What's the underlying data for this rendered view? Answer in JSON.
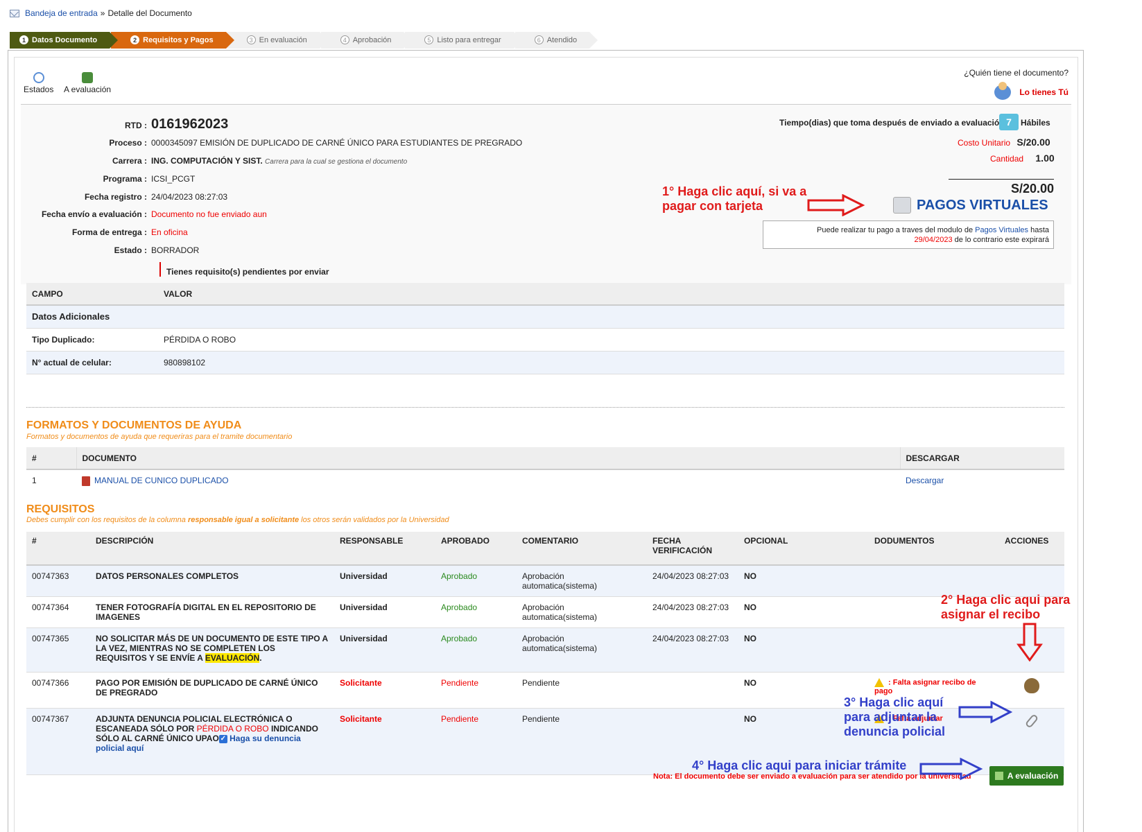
{
  "breadcrumb": {
    "inbox": "Bandeja de entrada",
    "sep": "»",
    "current": "Detalle del Documento"
  },
  "steps": [
    {
      "n": "1",
      "label": "Datos Documento",
      "state": "done"
    },
    {
      "n": "2",
      "label": "Requisitos y Pagos",
      "state": "active"
    },
    {
      "n": "3",
      "label": "En evaluación",
      "state": "pending"
    },
    {
      "n": "4",
      "label": "Aprobación",
      "state": "pending"
    },
    {
      "n": "5",
      "label": "Listo para entregar",
      "state": "pending"
    },
    {
      "n": "6",
      "label": "Atendido",
      "state": "pending"
    }
  ],
  "toolbar": {
    "estados": "Estados",
    "a_evaluacion": "A evaluación"
  },
  "who": {
    "question": "¿Quién tiene el documento?",
    "answer": "Lo tienes Tú"
  },
  "doc": {
    "rtd_label": "RTD :",
    "rtd": "0161962023",
    "proceso_label": "Proceso :",
    "proceso": "0000345097 EMISIÓN DE DUPLICADO DE CARNÉ ÚNICO PARA ESTUDIANTES DE PREGRADO",
    "carrera_label": "Carrera :",
    "carrera": "ING. COMPUTACIÓN Y SIST.",
    "carrera_note": "Carrera para la cual se gestiona el documento",
    "programa_label": "Programa :",
    "programa": "ICSI_PCGT",
    "fecha_registro_label": "Fecha registro :",
    "fecha_registro": "24/04/2023 08:27:03",
    "fecha_envio_label": "Fecha envío a evaluación :",
    "fecha_envio": "Documento no fue enviado aun",
    "forma_label": "Forma de entrega :",
    "forma": "En oficina",
    "estado_label": "Estado :",
    "estado": "BORRADOR",
    "pendientes": "Tienes requisito(s) pendientes por enviar"
  },
  "cost": {
    "tiempo_label": "Tiempo(dias) que toma después de enviado a evaluación",
    "dias": "7",
    "habiles": "Hábiles",
    "unit_label": "Costo Unitario",
    "unit": "S/20.00",
    "qty_label": "Cantidad",
    "qty": "1.00",
    "total": "S/20.00",
    "pagos": "PAGOS VIRTUALES",
    "note1": "Puede realizar tu pago a traves del modulo de",
    "note_link": "Pagos Virtuales",
    "note2": "hasta",
    "note_date": "29/04/2023",
    "note3": "de lo contrario este expirará"
  },
  "annotations": {
    "a1": "1° Haga clic aquí, si va a pagar con tarjeta",
    "a2": "2° Haga clic aqui para asignar el recibo",
    "a3": "3° Haga clic aquí para adjuntar la denuncia policial",
    "a4": "4° Haga clic aqui para iniciar trámite"
  },
  "extra": {
    "col_campo": "CAMPO",
    "col_valor": "VALOR",
    "section": "Datos Adicionales",
    "rows": [
      {
        "k": "Tipo Duplicado:",
        "v": "PÉRDIDA O ROBO"
      },
      {
        "k": "N° actual de celular:",
        "v": "980898102"
      }
    ]
  },
  "formatos": {
    "title": "FORMATOS Y DOCUMENTOS DE AYUDA",
    "subtitle": "Formatos y documentos de ayuda que requeriras para el tramite documentario",
    "col_n": "#",
    "col_doc": "DOCUMENTO",
    "col_desc": "DESCARGAR",
    "row": {
      "n": "1",
      "doc": "MANUAL DE CUNICO DUPLICADO",
      "desc": "Descargar"
    }
  },
  "requisitos": {
    "title": "REQUISITOS",
    "sub1": "Debes cumplir con los requisitos de la columna ",
    "sub_bold": "responsable igual a solicitante",
    "sub2": " los otros serán validados por la Universidad",
    "cols": [
      "#",
      "DESCRIPCIÓN",
      "RESPONSABLE",
      "APROBADO",
      "COMENTARIO",
      "FECHA VERIFICACIÓN",
      "OPCIONAL",
      "DODUMENTOS",
      "ACCIONES"
    ],
    "r1": {
      "id": "00747363",
      "desc": "DATOS PERSONALES COMPLETOS",
      "resp": "Universidad",
      "apr": "Aprobado",
      "com": "Aprobación automatica(sistema)",
      "fecha": "24/04/2023 08:27:03",
      "opc": "NO"
    },
    "r2": {
      "id": "00747364",
      "desc": "TENER FOTOGRAFÍA DIGITAL EN EL REPOSITORIO DE IMAGENES",
      "resp": "Universidad",
      "apr": "Aprobado",
      "com": "Aprobación automatica(sistema)",
      "fecha": "24/04/2023 08:27:03",
      "opc": "NO"
    },
    "r3": {
      "id": "00747365",
      "desc1": "NO SOLICITAR MÁS DE UN DOCUMENTO DE ESTE TIPO A LA VEZ,  MIENTRAS NO SE COMPLETEN LOS REQUISITOS Y SE ENVÍE A ",
      "desc_hl": "EVALUACIÓN",
      "desc2": ".",
      "resp": "Universidad",
      "apr": "Aprobado",
      "com": "Aprobación automatica(sistema)",
      "fecha": "24/04/2023 08:27:03",
      "opc": "NO"
    },
    "r4": {
      "id": "00747366",
      "desc": "PAGO POR EMISIÓN DE DUPLICADO DE CARNÉ ÚNICO DE PREGRADO",
      "resp": "Solicitante",
      "apr": "Pendiente",
      "com": "Pendiente",
      "opc": "NO",
      "docs": ": Falta asignar recibo de pago"
    },
    "r5": {
      "id": "00747367",
      "desc1": "ADJUNTA DENUNCIA POLICIAL ELECTRÓNICA O ESCANEADA SÓLO POR ",
      "desc_red": "PÉRDIDA O ROBO",
      "desc2": " INDICANDO SÓLO AL CARNÉ ÚNICO UPAO",
      "desc_link": "Haga su denuncia policial aquí",
      "resp": "Solicitante",
      "apr": "Pendiente",
      "com": "Pendiente",
      "opc": "NO",
      "docs": ": Falta adjuntar"
    }
  },
  "footer": {
    "nota": "Nota: El documento debe ser enviado a evaluación para ser atendido por la universidad",
    "btn": "A evaluación"
  }
}
